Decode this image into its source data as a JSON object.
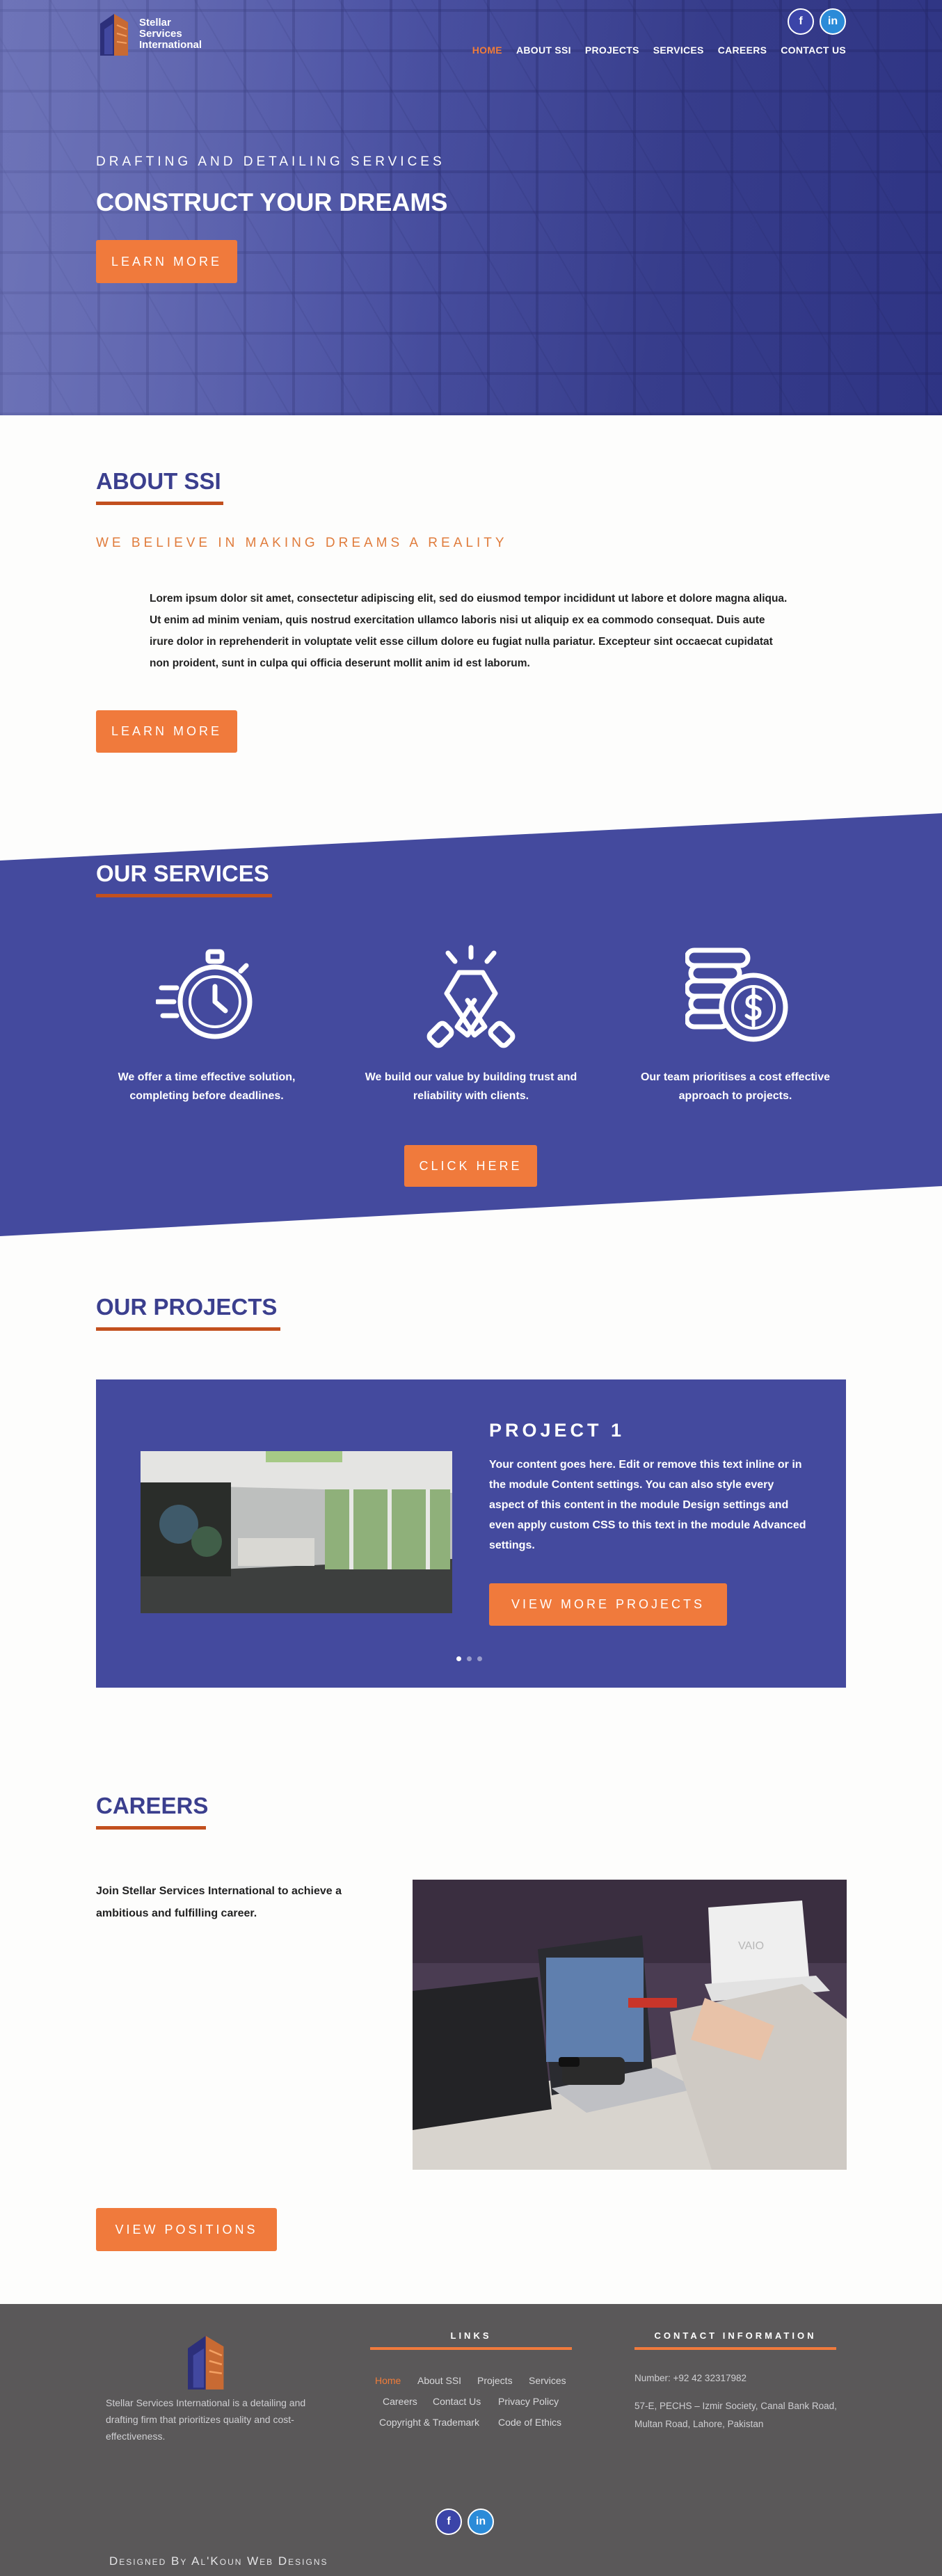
{
  "brand": {
    "name_line1": "Stellar",
    "name_line2": "Services",
    "name_line3": "International"
  },
  "social": {
    "facebook_glyph": "f",
    "linkedin_glyph": "in"
  },
  "nav": {
    "items": [
      "HOME",
      "ABOUT SSI",
      "PROJECTS",
      "SERVICES",
      "CAREERS",
      "CONTACT US"
    ],
    "active": "HOME"
  },
  "hero": {
    "kicker": "DRAFTING AND DETAILING SERVICES",
    "title": "CONSTRUCT YOUR DREAMS",
    "button": "LEARN MORE"
  },
  "about": {
    "heading": "ABOUT SSI",
    "subheading": "WE BELIEVE IN MAKING DREAMS A REALITY",
    "body": "Lorem ipsum dolor sit amet, consectetur adipiscing elit, sed do eiusmod tempor incididunt ut labore et dolore magna aliqua. Ut enim ad minim veniam, quis nostrud exercitation ullamco laboris nisi ut aliquip ex ea commodo consequat. Duis aute irure dolor in reprehenderit in voluptate velit esse cillum dolore eu fugiat nulla pariatur. Excepteur sint occaecat cupidatat non proident, sunt in culpa qui officia deserunt mollit anim id est laborum.",
    "button": "LEARN MORE"
  },
  "services": {
    "heading": "OUR SERVICES",
    "items": [
      {
        "icon": "stopwatch-icon",
        "text": "We offer a time effective solution, completing before deadlines."
      },
      {
        "icon": "handshake-icon",
        "text": "We build our value by building trust and reliability with clients."
      },
      {
        "icon": "coins-icon",
        "text": "Our team prioritises a cost effective approach to projects."
      }
    ],
    "button": "CLICK HERE"
  },
  "projects": {
    "heading": "OUR PROJECTS",
    "slide_title": "PROJECT 1",
    "slide_text": "Your content goes here. Edit or remove this text inline or in the module Content settings. You can also style every aspect of this content in the module Design settings and even apply custom CSS to this text in the module Advanced settings.",
    "button": "VIEW MORE PROJECTS",
    "slide_count": 3,
    "active_slide": 1
  },
  "careers": {
    "heading": "CAREERS",
    "text": "Join Stellar Services International to achieve a ambitious and fulfilling career.",
    "button": "VIEW POSITIONS",
    "laptop_brand": "VAIO"
  },
  "footer": {
    "about": "Stellar Services International is a detailing and drafting firm that prioritizes quality and cost-effectiveness.",
    "links_heading": "LINKS",
    "links": [
      "Home",
      "About SSI",
      "Projects",
      "Services",
      "Careers",
      "Contact Us",
      "Privacy Policy",
      "Copyright & Trademark",
      "Code of Ethics"
    ],
    "contact_heading": "CONTACT INFORMATION",
    "phone": "Number: +92 42 32317982",
    "address": "57-E, PECHS – Izmir Society, Canal Bank Road, Multan Road, Lahore, Pakistan",
    "credit": "Designed By Al'Koun Web Designs"
  },
  "colors": {
    "accent": "#f07a3c",
    "brand_blue": "#454b9e",
    "heading_blue": "#3b3f8e",
    "rule": "#c2501e",
    "footer_bg": "#5a5859"
  }
}
